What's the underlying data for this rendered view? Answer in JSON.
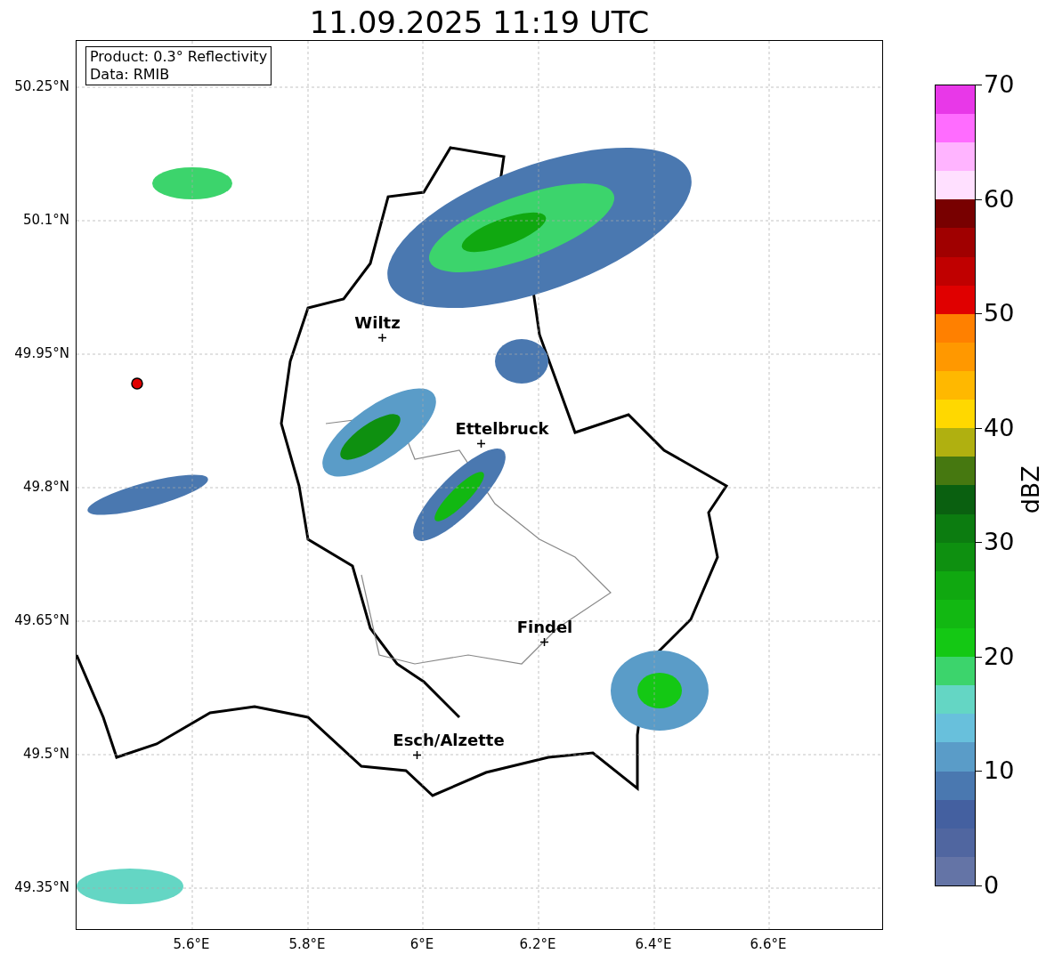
{
  "title": "11.09.2025 11:19 UTC",
  "info_box": [
    "Product: 0.3° Reflectivity",
    "Data: RMIB"
  ],
  "map": {
    "x_ticks": [
      "5.6°E",
      "5.8°E",
      "6°E",
      "6.2°E",
      "6.4°E",
      "6.6°E"
    ],
    "y_ticks": [
      "50.25°N",
      "50.1°N",
      "49.95°N",
      "49.8°N",
      "49.65°N",
      "49.5°N",
      "49.35°N"
    ],
    "places": [
      {
        "name": "Wiltz"
      },
      {
        "name": "Ettelbruck"
      },
      {
        "name": "Findel"
      },
      {
        "name": "Esch/Alzette"
      }
    ]
  },
  "colorbar": {
    "label": "dBZ",
    "ticks": [
      "70",
      "60",
      "50",
      "40",
      "30",
      "20",
      "10",
      "0"
    ],
    "segments": [
      {
        "color": "#6474a6"
      },
      {
        "color": "#5066a0"
      },
      {
        "color": "#4460a0"
      },
      {
        "color": "#4a78b0"
      },
      {
        "color": "#5a9cc8"
      },
      {
        "color": "#68c0dc"
      },
      {
        "color": "#64d6c4"
      },
      {
        "color": "#3cd46c"
      },
      {
        "color": "#14c814"
      },
      {
        "color": "#12b812"
      },
      {
        "color": "#10a810"
      },
      {
        "color": "#0e9010"
      },
      {
        "color": "#0c7c10"
      },
      {
        "color": "#0a6010"
      },
      {
        "color": "#467810"
      },
      {
        "color": "#b0b010"
      },
      {
        "color": "#ffd800"
      },
      {
        "color": "#ffb800"
      },
      {
        "color": "#ff9800"
      },
      {
        "color": "#ff8000"
      },
      {
        "color": "#e00000"
      },
      {
        "color": "#c00000"
      },
      {
        "color": "#a00000"
      },
      {
        "color": "#780000"
      },
      {
        "color": "#ffe0ff"
      },
      {
        "color": "#ffb4ff"
      },
      {
        "color": "#ff6cff"
      },
      {
        "color": "#e838e8"
      }
    ]
  }
}
